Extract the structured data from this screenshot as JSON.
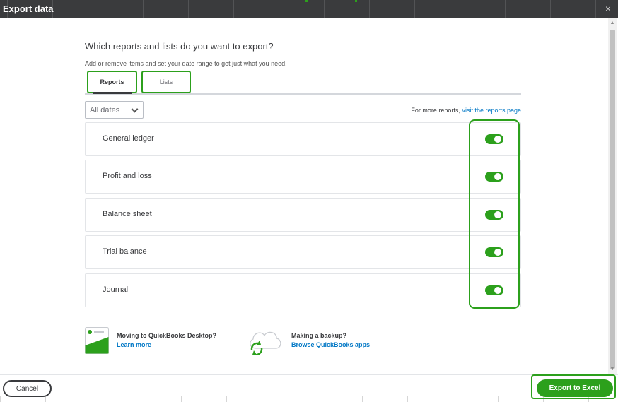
{
  "window": {
    "title": "Export data",
    "close_glyph": "×"
  },
  "main": {
    "heading": "Which reports and lists do you want to export?",
    "subheading": "Add or remove items and set your date range to get just what you need.",
    "tabs": [
      {
        "label": "Reports",
        "selected": true
      },
      {
        "label": "Lists",
        "selected": false
      }
    ],
    "date_filter": {
      "selected": "All dates"
    },
    "more_reports": {
      "text": "For more reports,",
      "link": "visit the reports page"
    },
    "reports": [
      {
        "label": "General ledger",
        "enabled": true
      },
      {
        "label": "Profit and loss",
        "enabled": true
      },
      {
        "label": "Balance sheet",
        "enabled": true
      },
      {
        "label": "Trial balance",
        "enabled": true
      },
      {
        "label": "Journal",
        "enabled": true
      }
    ]
  },
  "promos": {
    "desktop": {
      "title": "Moving to QuickBooks Desktop?",
      "link": "Learn more",
      "icon": "desktop-window-icon"
    },
    "backup": {
      "title": "Making a backup?",
      "link": "Browse QuickBooks apps",
      "icon": "cloud-sync-icon"
    }
  },
  "footer": {
    "cancel_label": "Cancel",
    "export_label": "Export to Excel"
  },
  "colors": {
    "accent": "#2ca01c",
    "link": "#0077c5",
    "titlebar": "#3a3b3d"
  }
}
